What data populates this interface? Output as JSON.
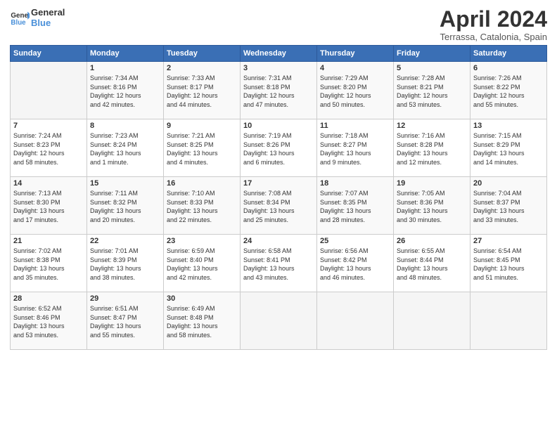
{
  "header": {
    "logo_line1": "General",
    "logo_line2": "Blue",
    "month_title": "April 2024",
    "location": "Terrassa, Catalonia, Spain"
  },
  "days_of_week": [
    "Sunday",
    "Monday",
    "Tuesday",
    "Wednesday",
    "Thursday",
    "Friday",
    "Saturday"
  ],
  "weeks": [
    [
      {
        "day": "",
        "info": ""
      },
      {
        "day": "1",
        "info": "Sunrise: 7:34 AM\nSunset: 8:16 PM\nDaylight: 12 hours\nand 42 minutes."
      },
      {
        "day": "2",
        "info": "Sunrise: 7:33 AM\nSunset: 8:17 PM\nDaylight: 12 hours\nand 44 minutes."
      },
      {
        "day": "3",
        "info": "Sunrise: 7:31 AM\nSunset: 8:18 PM\nDaylight: 12 hours\nand 47 minutes."
      },
      {
        "day": "4",
        "info": "Sunrise: 7:29 AM\nSunset: 8:20 PM\nDaylight: 12 hours\nand 50 minutes."
      },
      {
        "day": "5",
        "info": "Sunrise: 7:28 AM\nSunset: 8:21 PM\nDaylight: 12 hours\nand 53 minutes."
      },
      {
        "day": "6",
        "info": "Sunrise: 7:26 AM\nSunset: 8:22 PM\nDaylight: 12 hours\nand 55 minutes."
      }
    ],
    [
      {
        "day": "7",
        "info": "Sunrise: 7:24 AM\nSunset: 8:23 PM\nDaylight: 12 hours\nand 58 minutes."
      },
      {
        "day": "8",
        "info": "Sunrise: 7:23 AM\nSunset: 8:24 PM\nDaylight: 13 hours\nand 1 minute."
      },
      {
        "day": "9",
        "info": "Sunrise: 7:21 AM\nSunset: 8:25 PM\nDaylight: 13 hours\nand 4 minutes."
      },
      {
        "day": "10",
        "info": "Sunrise: 7:19 AM\nSunset: 8:26 PM\nDaylight: 13 hours\nand 6 minutes."
      },
      {
        "day": "11",
        "info": "Sunrise: 7:18 AM\nSunset: 8:27 PM\nDaylight: 13 hours\nand 9 minutes."
      },
      {
        "day": "12",
        "info": "Sunrise: 7:16 AM\nSunset: 8:28 PM\nDaylight: 13 hours\nand 12 minutes."
      },
      {
        "day": "13",
        "info": "Sunrise: 7:15 AM\nSunset: 8:29 PM\nDaylight: 13 hours\nand 14 minutes."
      }
    ],
    [
      {
        "day": "14",
        "info": "Sunrise: 7:13 AM\nSunset: 8:30 PM\nDaylight: 13 hours\nand 17 minutes."
      },
      {
        "day": "15",
        "info": "Sunrise: 7:11 AM\nSunset: 8:32 PM\nDaylight: 13 hours\nand 20 minutes."
      },
      {
        "day": "16",
        "info": "Sunrise: 7:10 AM\nSunset: 8:33 PM\nDaylight: 13 hours\nand 22 minutes."
      },
      {
        "day": "17",
        "info": "Sunrise: 7:08 AM\nSunset: 8:34 PM\nDaylight: 13 hours\nand 25 minutes."
      },
      {
        "day": "18",
        "info": "Sunrise: 7:07 AM\nSunset: 8:35 PM\nDaylight: 13 hours\nand 28 minutes."
      },
      {
        "day": "19",
        "info": "Sunrise: 7:05 AM\nSunset: 8:36 PM\nDaylight: 13 hours\nand 30 minutes."
      },
      {
        "day": "20",
        "info": "Sunrise: 7:04 AM\nSunset: 8:37 PM\nDaylight: 13 hours\nand 33 minutes."
      }
    ],
    [
      {
        "day": "21",
        "info": "Sunrise: 7:02 AM\nSunset: 8:38 PM\nDaylight: 13 hours\nand 35 minutes."
      },
      {
        "day": "22",
        "info": "Sunrise: 7:01 AM\nSunset: 8:39 PM\nDaylight: 13 hours\nand 38 minutes."
      },
      {
        "day": "23",
        "info": "Sunrise: 6:59 AM\nSunset: 8:40 PM\nDaylight: 13 hours\nand 42 minutes."
      },
      {
        "day": "24",
        "info": "Sunrise: 6:58 AM\nSunset: 8:41 PM\nDaylight: 13 hours\nand 43 minutes."
      },
      {
        "day": "25",
        "info": "Sunrise: 6:56 AM\nSunset: 8:42 PM\nDaylight: 13 hours\nand 46 minutes."
      },
      {
        "day": "26",
        "info": "Sunrise: 6:55 AM\nSunset: 8:44 PM\nDaylight: 13 hours\nand 48 minutes."
      },
      {
        "day": "27",
        "info": "Sunrise: 6:54 AM\nSunset: 8:45 PM\nDaylight: 13 hours\nand 51 minutes."
      }
    ],
    [
      {
        "day": "28",
        "info": "Sunrise: 6:52 AM\nSunset: 8:46 PM\nDaylight: 13 hours\nand 53 minutes."
      },
      {
        "day": "29",
        "info": "Sunrise: 6:51 AM\nSunset: 8:47 PM\nDaylight: 13 hours\nand 55 minutes."
      },
      {
        "day": "30",
        "info": "Sunrise: 6:49 AM\nSunset: 8:48 PM\nDaylight: 13 hours\nand 58 minutes."
      },
      {
        "day": "",
        "info": ""
      },
      {
        "day": "",
        "info": ""
      },
      {
        "day": "",
        "info": ""
      },
      {
        "day": "",
        "info": ""
      }
    ]
  ]
}
